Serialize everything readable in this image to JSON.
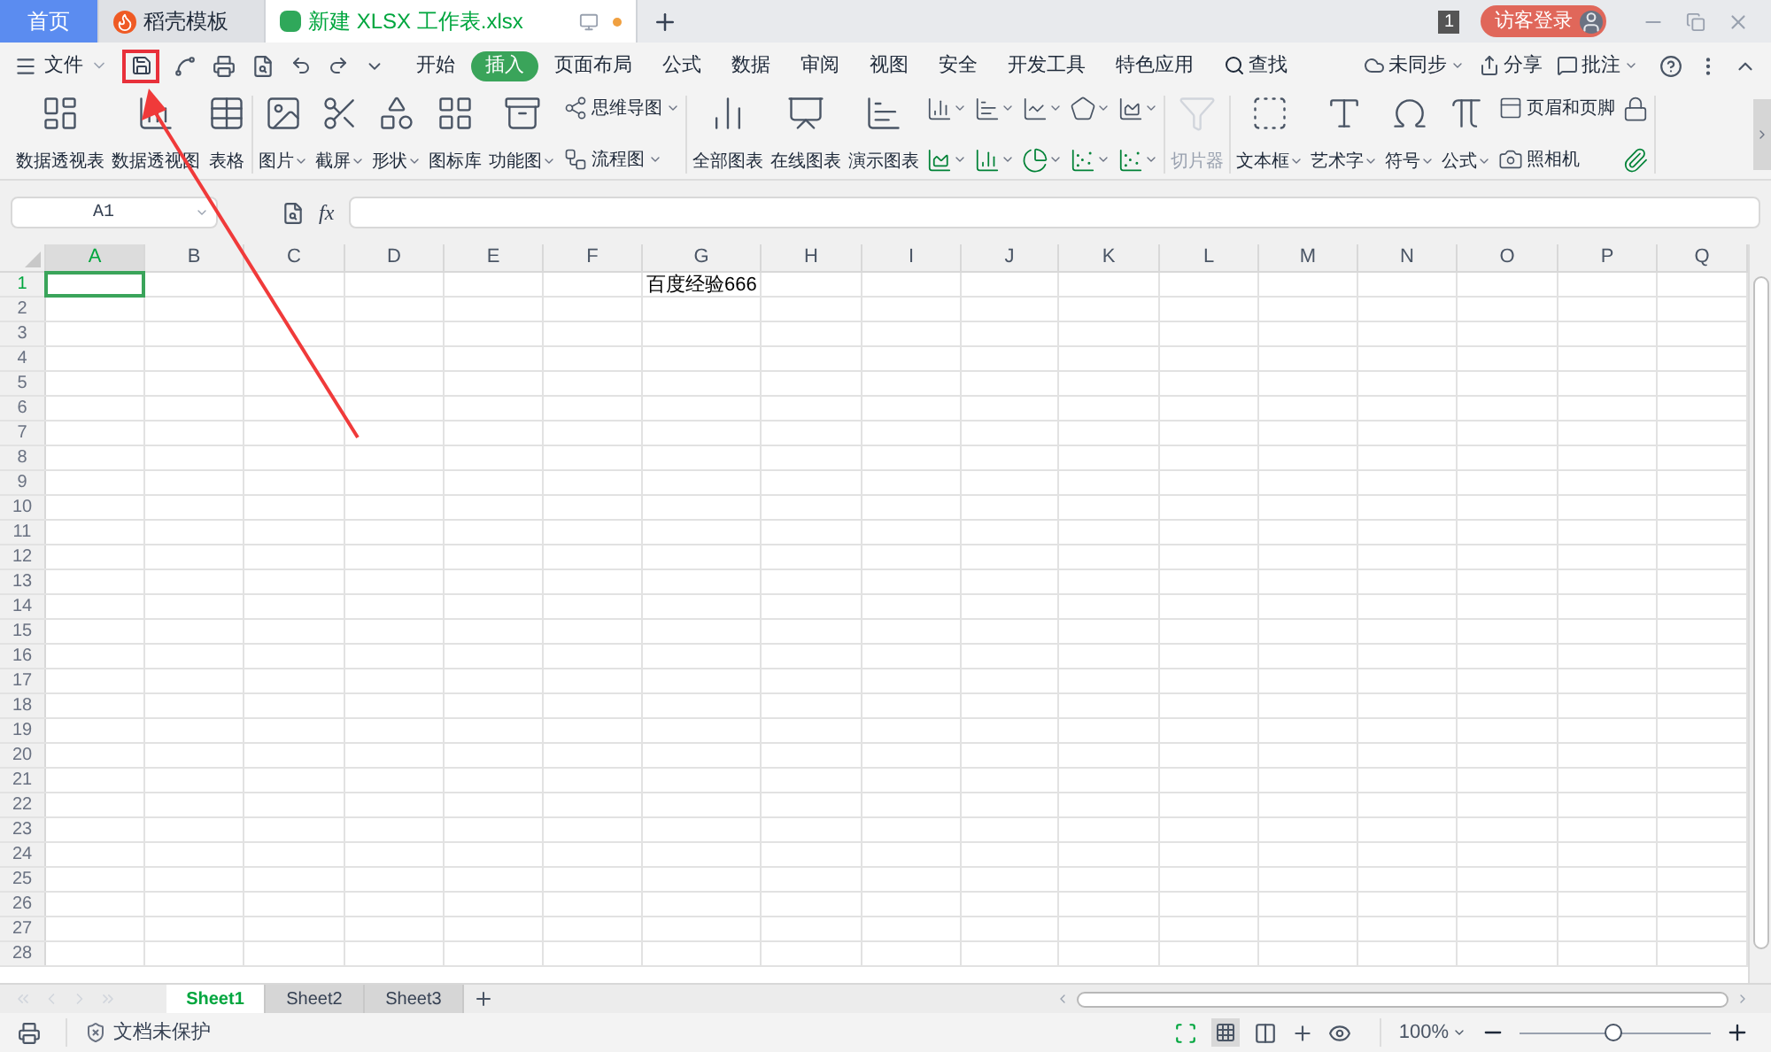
{
  "title_tabs": [
    {
      "kind": "home",
      "label": "首页",
      "selected": false
    },
    {
      "kind": "template",
      "label": "稻壳模板",
      "selected": false
    },
    {
      "kind": "sheet",
      "label": "新建 XLSX 工作表.xlsx",
      "selected": true,
      "unsaved": true
    }
  ],
  "window": {
    "badge": "1",
    "login": "访客登录"
  },
  "menu": {
    "file": "文件",
    "highlight_save": true,
    "tabs": [
      {
        "label": "开始",
        "selected": false,
        "kind": "tab"
      },
      {
        "label": "插入",
        "selected": true,
        "kind": "tab"
      },
      {
        "label": "页面布局",
        "selected": false,
        "kind": "tab"
      },
      {
        "label": "公式",
        "selected": false,
        "kind": "tab"
      },
      {
        "label": "数据",
        "selected": false,
        "kind": "tab"
      },
      {
        "label": "审阅",
        "selected": false,
        "kind": "tab"
      },
      {
        "label": "视图",
        "selected": false,
        "kind": "tab"
      },
      {
        "label": "安全",
        "selected": false,
        "kind": "tab"
      },
      {
        "label": "开发工具",
        "selected": false,
        "kind": "tab"
      },
      {
        "label": "特色应用",
        "selected": false,
        "kind": "tab"
      },
      {
        "label": "查找",
        "selected": false,
        "kind": "search"
      }
    ],
    "right": [
      {
        "label": "未同步",
        "dropdown": true
      },
      {
        "label": "分享",
        "dropdown": false
      },
      {
        "label": "批注",
        "dropdown": true
      }
    ]
  },
  "ribbon": [
    {
      "items": [
        {
          "kind": "large",
          "label": "数据透视表",
          "dropdown": false,
          "disabled": false
        },
        {
          "kind": "large",
          "label": "数据透视图",
          "dropdown": false,
          "disabled": false
        },
        {
          "kind": "large",
          "label": "表格",
          "dropdown": false,
          "disabled": false
        }
      ]
    },
    {
      "items": [
        {
          "kind": "large",
          "label": "图片",
          "dropdown": true,
          "disabled": false
        },
        {
          "kind": "large",
          "label": "截屏",
          "dropdown": true,
          "disabled": false
        },
        {
          "kind": "large",
          "label": "形状",
          "dropdown": true,
          "disabled": false
        },
        {
          "kind": "large",
          "label": "图标库",
          "dropdown": false,
          "disabled": false
        },
        {
          "kind": "large",
          "label": "功能图",
          "dropdown": true,
          "disabled": false
        },
        {
          "kind": "stack",
          "items": [
            {
              "kind": "small",
              "label": "思维导图",
              "dropdown": true
            },
            {
              "kind": "small",
              "label": "流程图",
              "dropdown": true
            }
          ]
        }
      ]
    },
    {
      "items": [
        {
          "kind": "large",
          "label": "全部图表",
          "dropdown": false,
          "disabled": false
        },
        {
          "kind": "large",
          "label": "在线图表",
          "dropdown": false,
          "disabled": false
        },
        {
          "kind": "large",
          "label": "演示图表",
          "dropdown": false,
          "disabled": false
        },
        {
          "kind": "stack",
          "items": [
            {
              "kind": "icon",
              "dropdown": true
            },
            {
              "kind": "icon",
              "dropdown": true
            }
          ]
        },
        {
          "kind": "stack",
          "items": [
            {
              "kind": "icon",
              "dropdown": true
            },
            {
              "kind": "icon",
              "dropdown": true
            }
          ]
        },
        {
          "kind": "stack",
          "items": [
            {
              "kind": "icon",
              "dropdown": true
            },
            {
              "kind": "icon",
              "dropdown": true
            }
          ]
        },
        {
          "kind": "stack",
          "items": [
            {
              "kind": "icon",
              "dropdown": true
            },
            {
              "kind": "icon",
              "dropdown": true
            }
          ]
        },
        {
          "kind": "stack",
          "items": [
            {
              "kind": "icon",
              "dropdown": true
            },
            {
              "kind": "icon",
              "dropdown": true
            }
          ]
        }
      ]
    },
    {
      "items": [
        {
          "kind": "large",
          "label": "切片器",
          "dropdown": false,
          "disabled": true
        }
      ]
    },
    {
      "items": [
        {
          "kind": "large",
          "label": "文本框",
          "dropdown": true,
          "disabled": false
        },
        {
          "kind": "large",
          "label": "艺术字",
          "dropdown": true,
          "disabled": false
        },
        {
          "kind": "large",
          "label": "符号",
          "dropdown": true,
          "disabled": false
        },
        {
          "kind": "large",
          "label": "公式",
          "dropdown": true,
          "disabled": false
        },
        {
          "kind": "stack",
          "items": [
            {
              "kind": "small",
              "label": "页眉和页脚",
              "dropdown": false
            },
            {
              "kind": "small",
              "label": "照相机",
              "dropdown": false
            }
          ]
        },
        {
          "kind": "stack",
          "items": [
            {
              "kind": "icon",
              "dropdown": false
            },
            {
              "kind": "icon",
              "dropdown": false
            }
          ]
        }
      ]
    }
  ],
  "formula_bar": {
    "name_box": "A1",
    "fx": "fx"
  },
  "columns": [
    {
      "label": "A",
      "selected": true
    },
    {
      "label": "B",
      "selected": false
    },
    {
      "label": "C",
      "selected": false
    },
    {
      "label": "D",
      "selected": false
    },
    {
      "label": "E",
      "selected": false
    },
    {
      "label": "F",
      "selected": false
    },
    {
      "label": "G",
      "selected": false
    },
    {
      "label": "H",
      "selected": false
    },
    {
      "label": "I",
      "selected": false
    },
    {
      "label": "J",
      "selected": false
    },
    {
      "label": "K",
      "selected": false
    },
    {
      "label": "L",
      "selected": false
    },
    {
      "label": "M",
      "selected": false
    },
    {
      "label": "N",
      "selected": false
    },
    {
      "label": "O",
      "selected": false
    },
    {
      "label": "P",
      "selected": false
    },
    {
      "label": "Q",
      "selected": false
    }
  ],
  "rows": [
    {
      "label": "1",
      "selected": true,
      "cells": {
        "G": "百度经验666"
      }
    },
    {
      "label": "2",
      "selected": false
    },
    {
      "label": "3",
      "selected": false
    },
    {
      "label": "4",
      "selected": false
    },
    {
      "label": "5",
      "selected": false
    },
    {
      "label": "6",
      "selected": false
    },
    {
      "label": "7",
      "selected": false
    },
    {
      "label": "8",
      "selected": false
    },
    {
      "label": "9",
      "selected": false
    },
    {
      "label": "10",
      "selected": false
    },
    {
      "label": "11",
      "selected": false
    },
    {
      "label": "12",
      "selected": false
    },
    {
      "label": "13",
      "selected": false
    },
    {
      "label": "14",
      "selected": false
    },
    {
      "label": "15",
      "selected": false
    },
    {
      "label": "16",
      "selected": false
    },
    {
      "label": "17",
      "selected": false
    },
    {
      "label": "18",
      "selected": false
    },
    {
      "label": "19",
      "selected": false
    },
    {
      "label": "20",
      "selected": false
    },
    {
      "label": "21",
      "selected": false
    },
    {
      "label": "22",
      "selected": false
    },
    {
      "label": "23",
      "selected": false
    },
    {
      "label": "24",
      "selected": false
    },
    {
      "label": "25",
      "selected": false
    },
    {
      "label": "26",
      "selected": false
    },
    {
      "label": "27",
      "selected": false
    },
    {
      "label": "28",
      "selected": false
    }
  ],
  "sheets": [
    {
      "label": "Sheet1",
      "selected": true
    },
    {
      "label": "Sheet2",
      "selected": false
    },
    {
      "label": "Sheet3",
      "selected": false
    }
  ],
  "status_bar": {
    "protection": "文档未保护",
    "zoom": "100%",
    "zoom_slider": {
      "level": 0.49
    }
  },
  "annotation": {
    "arrow": true
  }
}
